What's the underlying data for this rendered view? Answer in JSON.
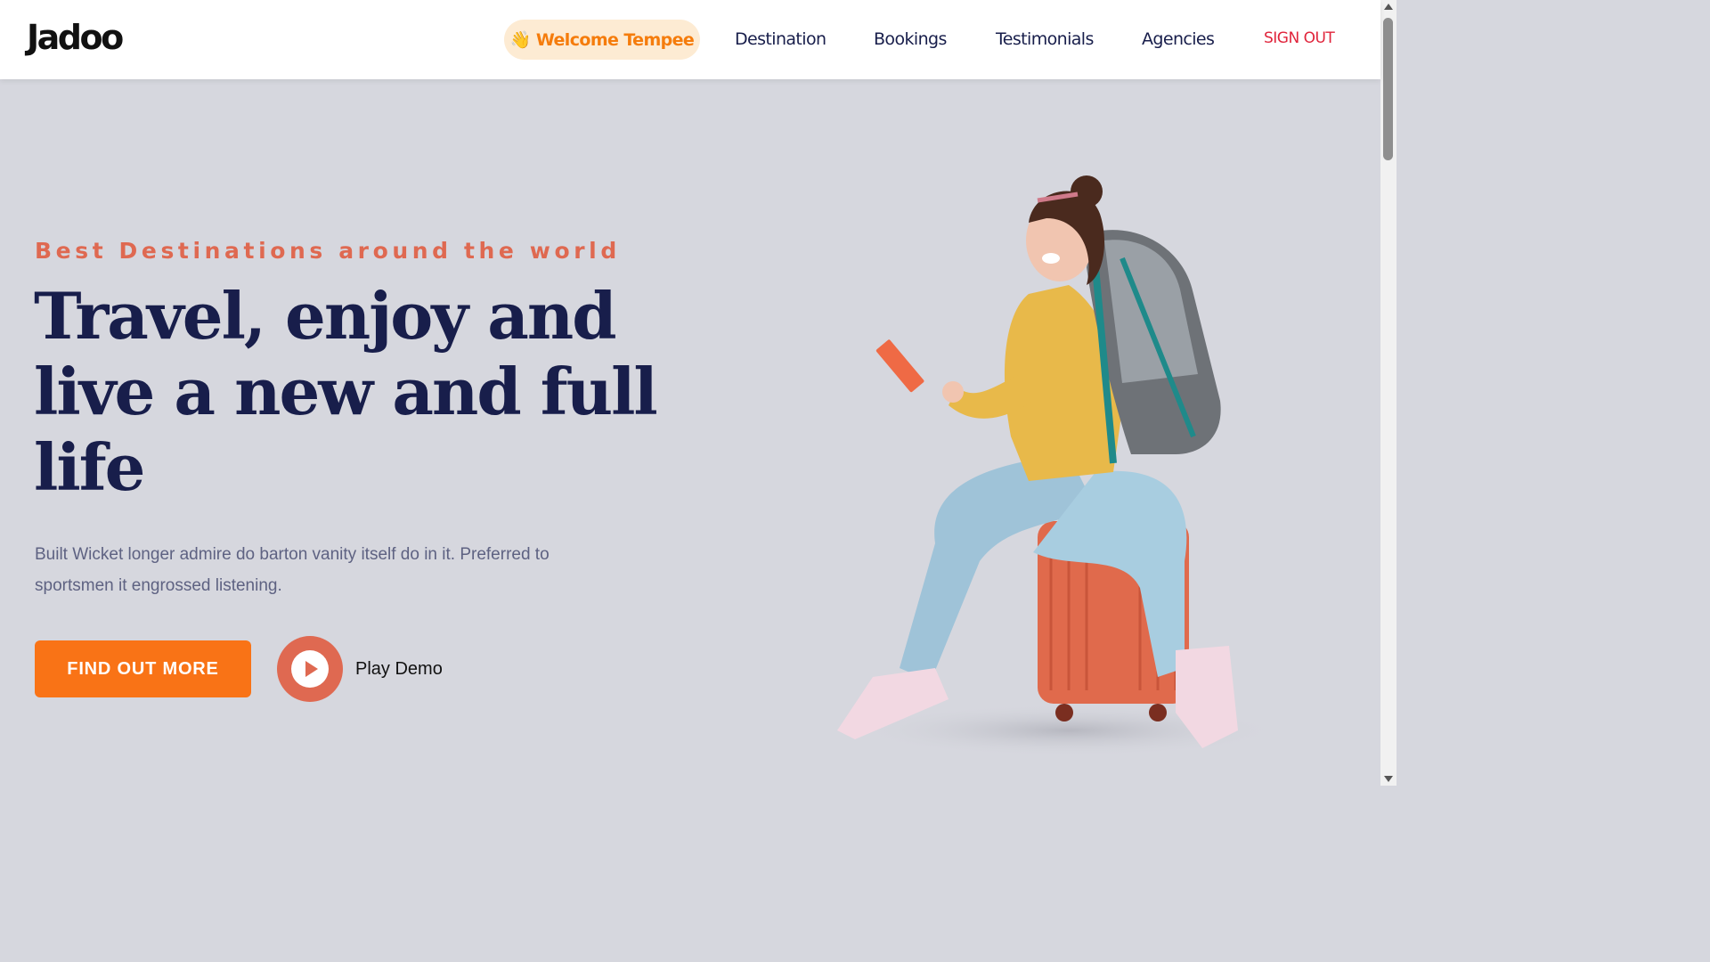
{
  "nav": {
    "logo": "Jadoo",
    "welcome_emoji": "👋",
    "welcome_text": "Welcome Tempee",
    "links": [
      "Destination",
      "Bookings",
      "Testimonials",
      "Agencies"
    ],
    "signout": "SIGN OUT"
  },
  "hero": {
    "tagline": "Best Destinations around the world",
    "headline_lines": [
      "Travel, enjoy and",
      "live a new and full",
      "life"
    ],
    "description": "Built Wicket longer admire do barton vanity itself do in it. Preferred to sportsmen it engrossed listening.",
    "cta_label": "FIND OUT MORE",
    "play_label": "Play Demo"
  },
  "colors": {
    "accent_orange": "#f97316",
    "tagline_coral": "#df6951",
    "headline_navy": "#181e4b",
    "signout_red": "#e0243b",
    "background": "#d6d7de"
  },
  "icons": [
    "waving-hand-icon",
    "play-icon",
    "scroll-up-arrow-icon",
    "scroll-down-arrow-icon"
  ]
}
